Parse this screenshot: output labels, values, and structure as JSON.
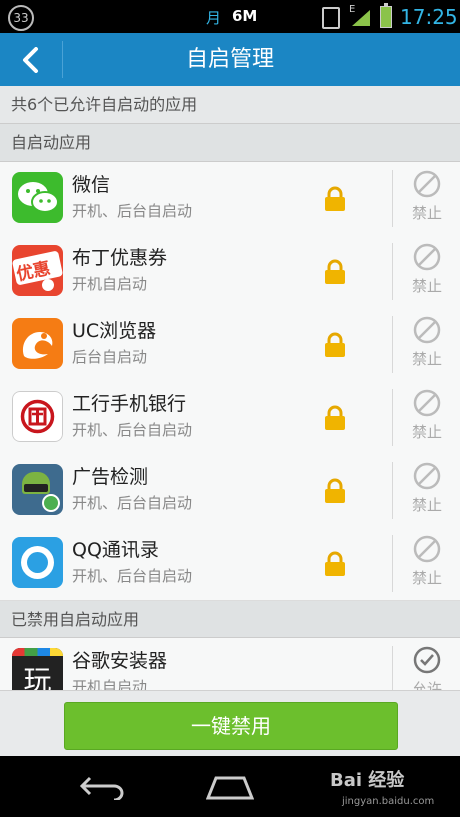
{
  "status_bar": {
    "badge": "33",
    "month_char": "月",
    "data_rate": "6M",
    "network": "E",
    "time": "17:25"
  },
  "header": {
    "title": "自启管理"
  },
  "summary": "共6个已允许自启动的应用",
  "sections": {
    "enabled": "自启动应用",
    "disabled": "已禁用自启动应用"
  },
  "apps": [
    {
      "name": "微信",
      "sub": "开机、后台自启动",
      "action": "禁止",
      "icon": "wechat-icon"
    },
    {
      "name": "布丁优惠券",
      "sub": "开机自启动",
      "action": "禁止",
      "icon": "coupon-icon"
    },
    {
      "name": "UC浏览器",
      "sub": "后台自启动",
      "action": "禁止",
      "icon": "uc-browser-icon"
    },
    {
      "name": "工行手机银行",
      "sub": "开机、后台自启动",
      "action": "禁止",
      "icon": "icbc-icon"
    },
    {
      "name": "广告检测",
      "sub": "开机、后台自启动",
      "action": "禁止",
      "icon": "ad-detect-icon"
    },
    {
      "name": "QQ通讯录",
      "sub": "开机、后台自启动",
      "action": "禁止",
      "icon": "qq-contacts-icon"
    }
  ],
  "disabled_apps": [
    {
      "name": "谷歌安装器",
      "sub": "开机自启动",
      "action": "允许",
      "icon": "google-installer-icon",
      "icon_text": "玩"
    }
  ],
  "disable_all_label": "一键禁用",
  "watermark": {
    "text": "Bai 经验",
    "url": "jingyan.baidu.com"
  },
  "colors": {
    "header": "#1b86c4",
    "button": "#6cbf2d",
    "lock": "#f0b400"
  }
}
